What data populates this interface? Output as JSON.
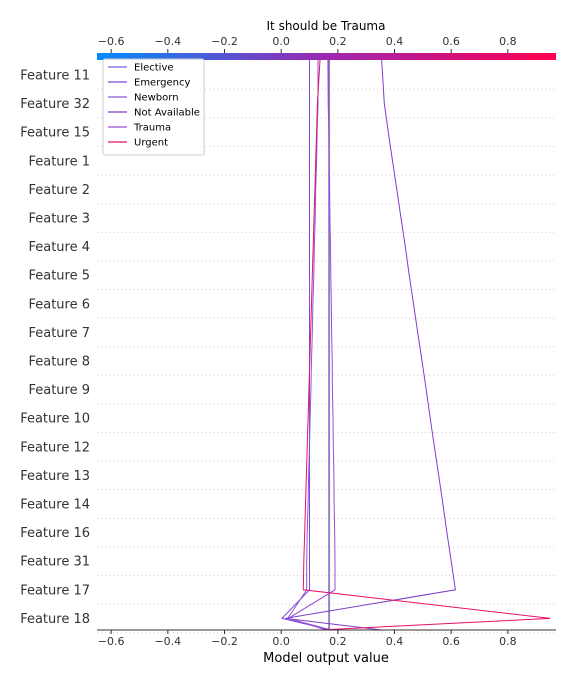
{
  "chart_data": {
    "type": "line",
    "title": "It should be Trauma",
    "xlabel": "Model output value",
    "xlim": [
      -0.65,
      0.97
    ],
    "x_ticks": [
      -0.6,
      -0.4,
      -0.2,
      0.0,
      0.2,
      0.4,
      0.6,
      0.8
    ],
    "x_tick_labels": [
      "−0.6",
      "−0.4",
      "−0.2",
      "0.0",
      "0.2",
      "0.4",
      "0.6",
      "0.8"
    ],
    "base_value": 0.17,
    "features": [
      "Feature 11",
      "Feature 32",
      "Feature 15",
      "Feature 1",
      "Feature 2",
      "Feature 3",
      "Feature 4",
      "Feature 5",
      "Feature 6",
      "Feature 7",
      "Feature 8",
      "Feature 9",
      "Feature 10",
      "Feature 12",
      "Feature 13",
      "Feature 14",
      "Feature 16",
      "Feature 31",
      "Feature 17",
      "Feature 18"
    ],
    "legend_position": "top-left",
    "grid": "dotted horizontal",
    "colorbar": {
      "low_color": "#008bfb",
      "mid_color": "#9c27b0",
      "high_color": "#ff0051"
    },
    "series": [
      {
        "name": "Elective",
        "color": "#7a5ae0",
        "x": [
          0.168,
          0.168,
          0.168,
          0.168,
          0.168,
          0.168,
          0.168,
          0.168,
          0.168,
          0.168,
          0.168,
          0.168,
          0.168,
          0.168,
          0.168,
          0.168,
          0.168,
          0.168,
          0.168,
          0.168,
          0.168
        ]
      },
      {
        "name": "Emergency",
        "color": "#7b4ad6",
        "x": [
          0.175,
          0.003,
          0.1,
          0.1,
          0.1,
          0.1,
          0.1,
          0.1,
          0.1,
          0.1,
          0.1,
          0.1,
          0.1,
          0.1,
          0.1,
          0.1,
          0.1,
          0.1,
          0.1,
          0.1,
          0.1
        ]
      },
      {
        "name": "Newborn",
        "color": "#8a56d8",
        "x": [
          0.177,
          0.023,
          0.09,
          0.09,
          0.092,
          0.095,
          0.097,
          0.1,
          0.102,
          0.105,
          0.107,
          0.11,
          0.112,
          0.115,
          0.117,
          0.12,
          0.122,
          0.125,
          0.127,
          0.13,
          0.13
        ]
      },
      {
        "name": "Not Available",
        "color": "#7e3fc8",
        "x": [
          0.355,
          0.015,
          0.615,
          0.6,
          0.585,
          0.571,
          0.556,
          0.541,
          0.526,
          0.512,
          0.497,
          0.482,
          0.467,
          0.452,
          0.438,
          0.423,
          0.408,
          0.393,
          0.378,
          0.364,
          0.355
        ]
      },
      {
        "name": "Trauma",
        "color": "#9b4bd0",
        "x": [
          0.16,
          0.025,
          0.19,
          0.19,
          0.189,
          0.187,
          0.186,
          0.184,
          0.183,
          0.181,
          0.18,
          0.178,
          0.177,
          0.175,
          0.174,
          0.172,
          0.171,
          0.169,
          0.168,
          0.166,
          0.165
        ]
      },
      {
        "name": "Urgent",
        "color": "#e8106a",
        "x": [
          0.137,
          0.95,
          0.078,
          0.08,
          0.083,
          0.086,
          0.089,
          0.092,
          0.095,
          0.098,
          0.101,
          0.104,
          0.107,
          0.11,
          0.113,
          0.116,
          0.119,
          0.122,
          0.125,
          0.128,
          0.137
        ]
      }
    ]
  }
}
